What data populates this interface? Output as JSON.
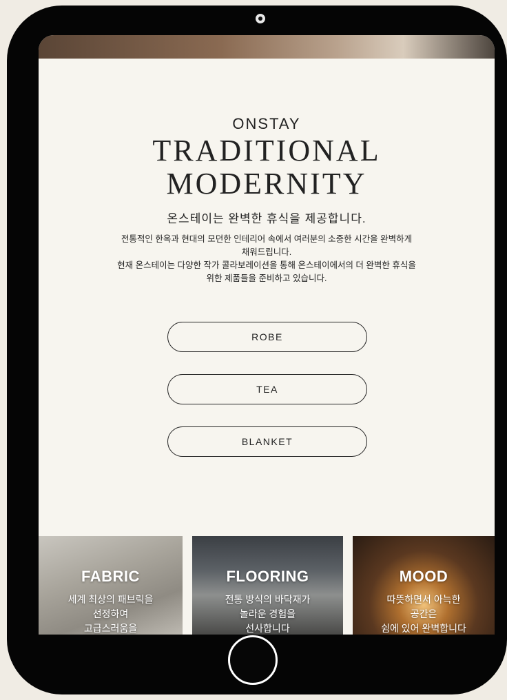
{
  "brand": "ONSTAY",
  "title_line1": "TRADITIONAL",
  "title_line2": "MODERNITY",
  "subtitle": "온스테이는 완벽한 휴식을 제공합니다.",
  "description": {
    "line1": "전통적인 한옥과 현대의 모던한 인테리어 속에서 여러분의 소중한 시간을 완벽하게",
    "line2": "채워드립니다.",
    "line3": "현재 온스테이는 다양한 작가 콜라보레이션을 통해 온스테이에서의 더 완벽한 휴식을",
    "line4": "위한 제품들을 준비하고 있습니다."
  },
  "buttons": [
    {
      "label": "ROBE"
    },
    {
      "label": "TEA"
    },
    {
      "label": "BLANKET"
    }
  ],
  "cards": [
    {
      "title": "FABRIC",
      "line1": "세계 최상의 패브릭을",
      "line2": "선정하여",
      "line3": "고급스러움을"
    },
    {
      "title": "FLOORING",
      "line1": "전통 방식의 바닥재가",
      "line2": "놀라운 경험을",
      "line3": "선사합니다"
    },
    {
      "title": "MOOD",
      "line1": "따뜻하면서 아늑한",
      "line2": "공간은",
      "line3": "쉼에 있어 완벽합니다"
    }
  ],
  "colors": {
    "page_bg": "#f0ece4",
    "screen_bg": "#f7f5ef",
    "device": "#050505",
    "text": "#222222"
  }
}
